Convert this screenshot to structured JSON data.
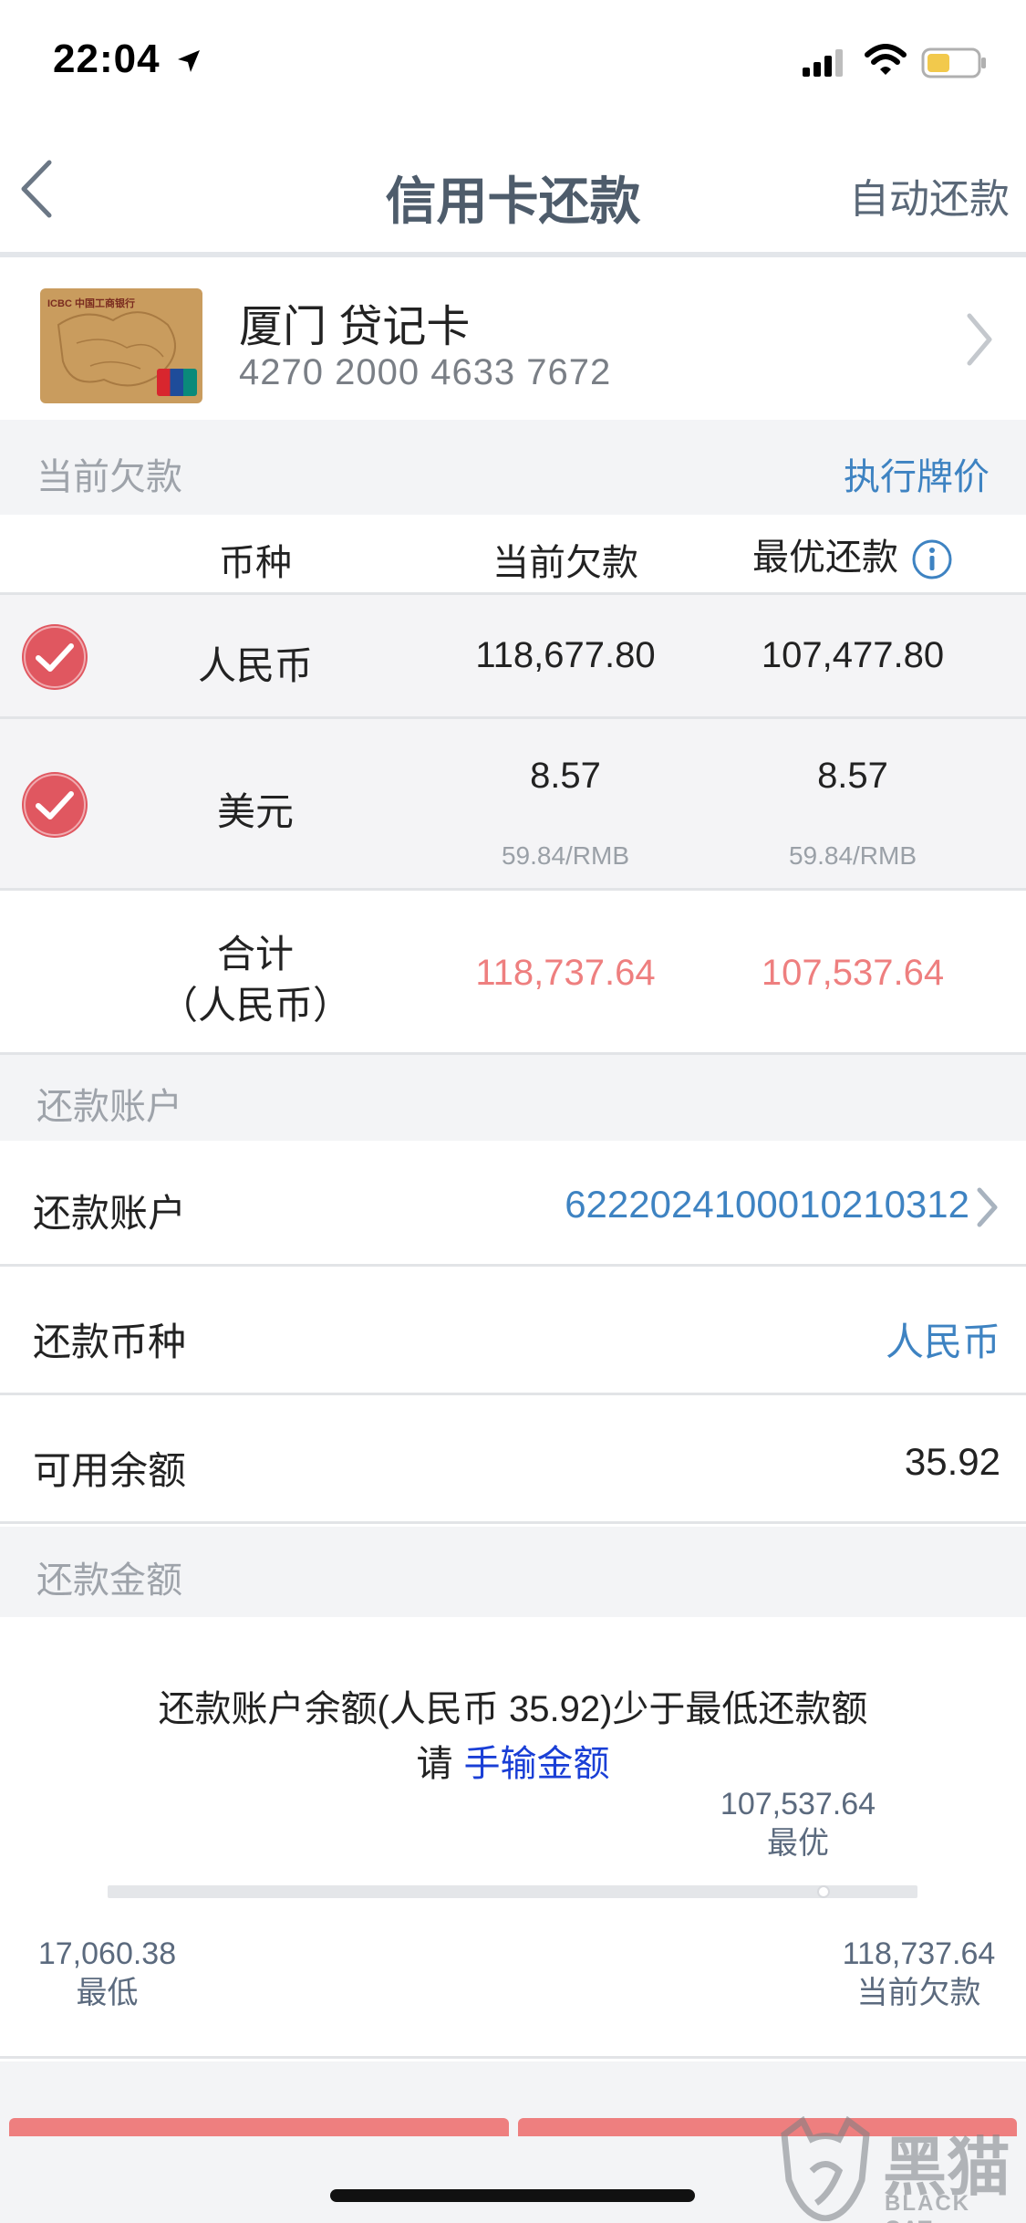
{
  "status_bar": {
    "time": "22:04"
  },
  "nav": {
    "title": "信用卡还款",
    "right_action": "自动还款"
  },
  "card": {
    "name": "厦门 贷记卡",
    "number": "4270 2000 4633 7672",
    "bank_logo_text": "ICBC 中国工商银行"
  },
  "debt_section": {
    "label": "当前欠款",
    "link": "执行牌价"
  },
  "table": {
    "headers": [
      "币种",
      "当前欠款",
      "最优还款"
    ],
    "rows": [
      {
        "currency": "人民币",
        "current": "118,677.80",
        "optimal": "107,477.80",
        "checked": true
      },
      {
        "currency": "美元",
        "current": "8.57",
        "optimal": "8.57",
        "current_sub": "59.84/RMB",
        "optimal_sub": "59.84/RMB",
        "checked": true
      }
    ],
    "total": {
      "label_line1": "合计",
      "label_line2": "（人民币）",
      "current": "118,737.64",
      "optimal": "107,537.64"
    }
  },
  "account_section": {
    "label": "还款账户"
  },
  "account_rows": [
    {
      "label": "还款账户",
      "value": "6222024100010210312"
    },
    {
      "label": "还款币种",
      "value": "人民币"
    },
    {
      "label": "可用余额",
      "value": "35.92"
    }
  ],
  "amount_section": {
    "label": "还款金额"
  },
  "amount": {
    "message": "还款账户余额(人民币 35.92)少于最低还款额",
    "prompt_prefix": "请",
    "prompt_link": "手输金额",
    "optimal_value": "107,537.64",
    "optimal_label": "最优",
    "min_value": "17,060.38",
    "min_label": "最低",
    "max_value": "118,737.64",
    "max_label": "当前欠款",
    "slider_position": 0.884
  },
  "watermark": {
    "text": "黑猫",
    "sub": "BLACK CAT"
  },
  "colors": {
    "accent_blue": "#3e83c2",
    "red": "#ee7f7f",
    "check_red": "#e05760",
    "link_blue": "#1a3fd6"
  }
}
